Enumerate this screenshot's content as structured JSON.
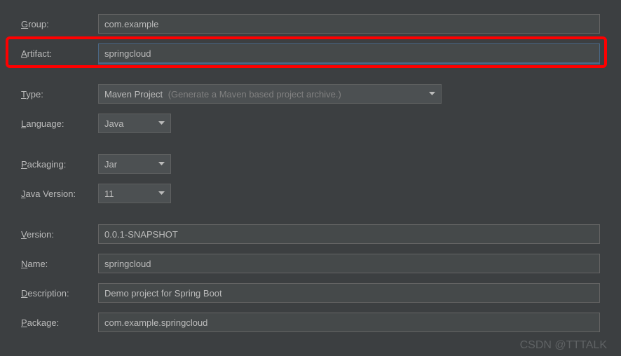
{
  "labels": {
    "group": "roup:",
    "group_u": "G",
    "artifact": "rtifact:",
    "artifact_u": "A",
    "type": "ype:",
    "type_u": "T",
    "language": "anguage:",
    "language_u": "L",
    "packaging": "ackaging:",
    "packaging_u": "P",
    "java_version": "ava Version:",
    "java_version_u": "J",
    "version": "ersion:",
    "version_u": "V",
    "name": "ame:",
    "name_u": "N",
    "description": "escription:",
    "description_u": "D",
    "package": "ackage:",
    "package_u": "P"
  },
  "values": {
    "group": "com.example",
    "artifact": "springcloud",
    "type": "Maven Project",
    "type_hint": "(Generate a Maven based project archive.)",
    "language": "Java",
    "packaging": "Jar",
    "java_version": "11",
    "version": "0.0.1-SNAPSHOT",
    "name": "springcloud",
    "description": "Demo project for Spring Boot",
    "package": "com.example.springcloud"
  },
  "watermark": "CSDN @TTTALK"
}
